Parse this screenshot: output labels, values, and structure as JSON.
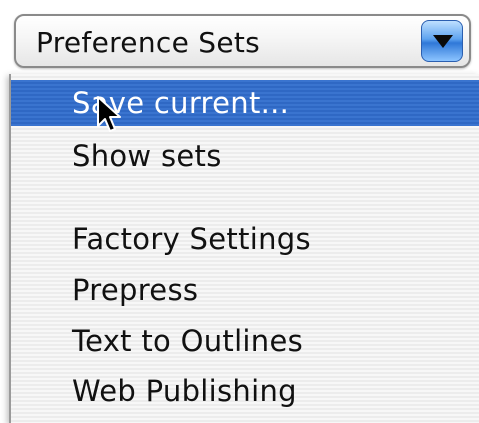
{
  "popup": {
    "label": "Preference Sets"
  },
  "menu": {
    "items": [
      {
        "label": "Save current...",
        "highlighted": true
      },
      {
        "label": "Show sets",
        "highlighted": false
      },
      {
        "label": "Factory Settings",
        "highlighted": false
      },
      {
        "label": "Prepress",
        "highlighted": false
      },
      {
        "label": "Text to Outlines",
        "highlighted": false
      },
      {
        "label": "Web Publishing",
        "highlighted": false
      }
    ]
  },
  "icons": {
    "popup_arrow": "chevron-down-icon",
    "cursor": "mouse-pointer-icon"
  },
  "colors": {
    "highlight": "#2f68c4",
    "arrow_button": "#5ea3f0"
  }
}
